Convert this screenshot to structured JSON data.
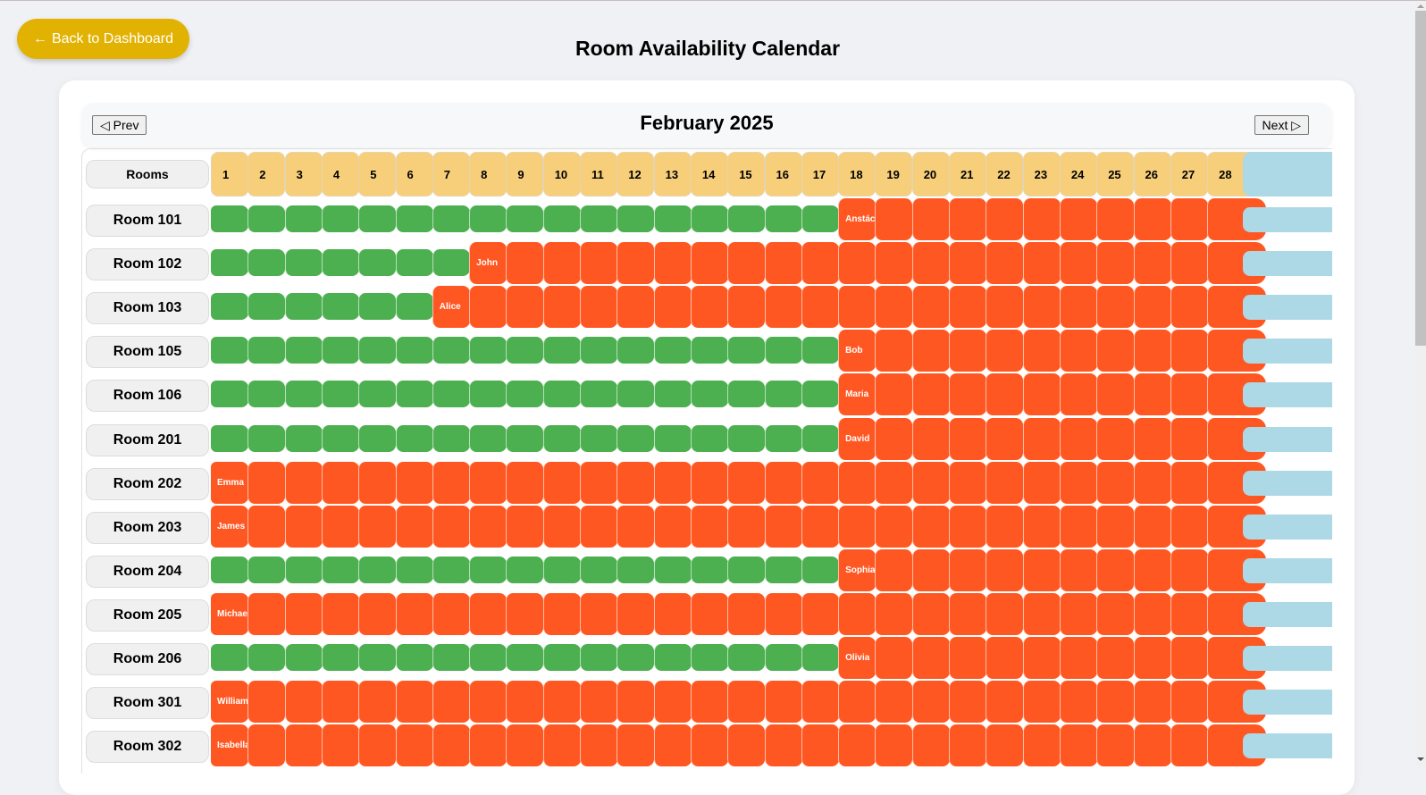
{
  "back_button": {
    "label": "Back to Dashboard",
    "icon": "arrow-left-icon",
    "arrow": "←"
  },
  "page_title": "Room Availability Calendar",
  "calendar": {
    "month_label": "February 2025",
    "prev_label": "◁ Prev",
    "next_label": "Next ▷",
    "rooms_header": "Rooms",
    "days": [
      1,
      2,
      3,
      4,
      5,
      6,
      7,
      8,
      9,
      10,
      11,
      12,
      13,
      14,
      15,
      16,
      17,
      18,
      19,
      20,
      21,
      22,
      23,
      24,
      25,
      26,
      27,
      28
    ],
    "colors": {
      "available": "#4caf50",
      "occupied": "#ff5722",
      "header": "#f7cf7b",
      "overflow": "#add8e6"
    },
    "rooms": [
      {
        "name": "Room 101",
        "occupied_from": 18,
        "guest": "Anstác"
      },
      {
        "name": "Room 102",
        "occupied_from": 8,
        "guest": "John"
      },
      {
        "name": "Room 103",
        "occupied_from": 7,
        "guest": "Alice"
      },
      {
        "name": "Room 105",
        "occupied_from": 18,
        "guest": "Bob"
      },
      {
        "name": "Room 106",
        "occupied_from": 18,
        "guest": "Maria"
      },
      {
        "name": "Room 201",
        "occupied_from": 18,
        "guest": "David"
      },
      {
        "name": "Room 202",
        "occupied_from": 1,
        "guest": "Emma"
      },
      {
        "name": "Room 203",
        "occupied_from": 1,
        "guest": "James"
      },
      {
        "name": "Room 204",
        "occupied_from": 18,
        "guest": "Sophia"
      },
      {
        "name": "Room 205",
        "occupied_from": 1,
        "guest": "Michael"
      },
      {
        "name": "Room 206",
        "occupied_from": 18,
        "guest": "Olivia"
      },
      {
        "name": "Room 301",
        "occupied_from": 1,
        "guest": "William"
      },
      {
        "name": "Room 302",
        "occupied_from": 1,
        "guest": "Isabella"
      }
    ]
  }
}
